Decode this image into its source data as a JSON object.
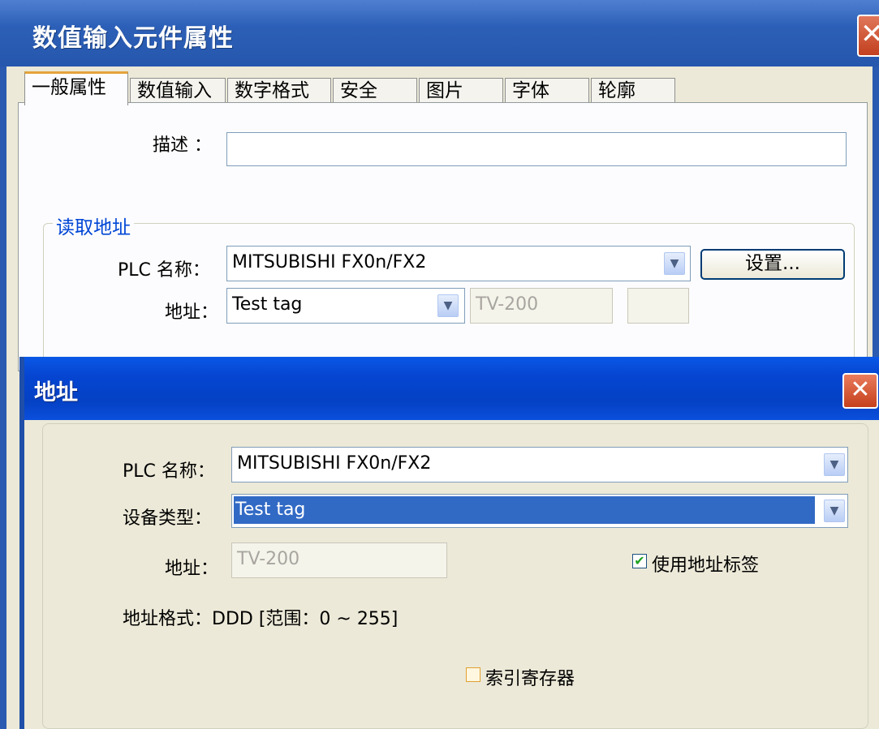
{
  "main_dialog": {
    "title": "数值输入元件属性",
    "close_glyph": "✕",
    "tabs": [
      {
        "label": "一般属性",
        "active": true
      },
      {
        "label": "数值输入",
        "active": false
      },
      {
        "label": "数字格式",
        "active": false
      },
      {
        "label": "安全",
        "active": false
      },
      {
        "label": "图片",
        "active": false
      },
      {
        "label": "字体",
        "active": false
      },
      {
        "label": "轮廓",
        "active": false
      }
    ],
    "description_label": "描述 ：",
    "description_value": "",
    "read_address": {
      "group_title": "读取地址",
      "plc_label": "PLC 名称：",
      "plc_value": "MITSUBISHI FX0n/FX2",
      "settings_button": "设置...",
      "address_label": "地址：",
      "address_value": "Test tag",
      "address_readonly": "TV-200",
      "extra_field": ""
    }
  },
  "address_dialog": {
    "title": "地址",
    "close_glyph": "✕",
    "plc_label": "PLC 名称：",
    "plc_value": "MITSUBISHI FX0n/FX2",
    "device_type_label": "设备类型：",
    "device_type_value": "Test tag",
    "address_label": "地址：",
    "address_value": "TV-200",
    "use_address_tag_label": "使用地址标签",
    "use_address_tag_checked": true,
    "address_format_text": "地址格式：DDD [范围：0 ~ 255]",
    "index_register_label": "索引寄存器",
    "index_register_checked": false
  },
  "icons": {
    "dropdown_arrow": "chevron-down-icon",
    "check_mark": "✔"
  },
  "colors": {
    "title_bar": "#2c5fb7",
    "title_bar_active": "#0545d1",
    "close_button": "#c5401c",
    "selection": "#316ac5",
    "group_title": "#0046d5",
    "dialog_bg": "#ece9d8"
  }
}
